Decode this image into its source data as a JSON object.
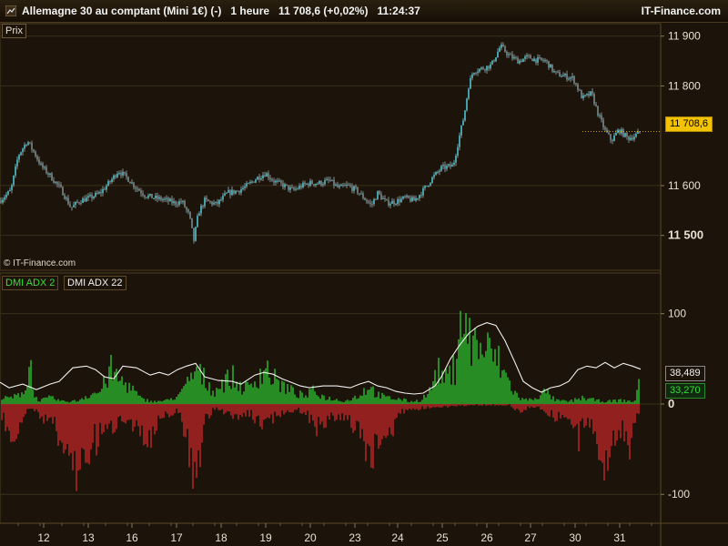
{
  "header": {
    "title": "Allemagne 30 au comptant (Mini 1€) (-)   1 heure   11 708,6 (+0,02%)   11:24:37",
    "brand": "IT-Finance.com"
  },
  "price_panel": {
    "label": "Prix",
    "copyright": "© IT-Finance.com",
    "current_price": "11 708,6",
    "axis_ticks": [
      "11 900",
      "11 800",
      "11 600",
      "11 500"
    ]
  },
  "indicator_panel": {
    "label_dmi": "DMI ADX 2",
    "label_adx": "DMI ADX 22",
    "adx_value": "38,489",
    "dmi_value": "33,270",
    "axis_ticks": [
      "100",
      "0",
      "-100"
    ]
  },
  "x_axis": {
    "ticks": [
      "12",
      "13",
      "16",
      "17",
      "18",
      "19",
      "20",
      "23",
      "24",
      "25",
      "26",
      "27",
      "30",
      "31"
    ]
  },
  "colors": {
    "background": "#1c140a",
    "candle_up": "#4fc3d0",
    "candle_down": "#7a8a8e",
    "dmi_positive": "#2fbf2f",
    "dmi_negative": "#c42626",
    "adx_line": "#f0f0f0",
    "price_badge": "#f3c200"
  },
  "chart_data": [
    {
      "type": "candlestick",
      "ylim": [
        11430,
        11925
      ],
      "yticks": [
        11900,
        11800,
        11600,
        11500
      ],
      "close_path": [
        [
          0,
          11570
        ],
        [
          12,
          11590
        ],
        [
          20,
          11660
        ],
        [
          30,
          11690
        ],
        [
          38,
          11665
        ],
        [
          45,
          11640
        ],
        [
          55,
          11620
        ],
        [
          68,
          11590
        ],
        [
          78,
          11555
        ],
        [
          88,
          11570
        ],
        [
          98,
          11575
        ],
        [
          110,
          11585
        ],
        [
          122,
          11610
        ],
        [
          130,
          11630
        ],
        [
          140,
          11615
        ],
        [
          150,
          11595
        ],
        [
          160,
          11580
        ],
        [
          170,
          11575
        ],
        [
          180,
          11572
        ],
        [
          192,
          11565
        ],
        [
          200,
          11568
        ],
        [
          208,
          11540
        ],
        [
          213,
          11490
        ],
        [
          218,
          11545
        ],
        [
          225,
          11570
        ],
        [
          238,
          11562
        ],
        [
          250,
          11585
        ],
        [
          262,
          11590
        ],
        [
          272,
          11600
        ],
        [
          282,
          11615
        ],
        [
          292,
          11625
        ],
        [
          300,
          11610
        ],
        [
          312,
          11600
        ],
        [
          322,
          11590
        ],
        [
          332,
          11600
        ],
        [
          340,
          11605
        ],
        [
          352,
          11605
        ],
        [
          362,
          11610
        ],
        [
          372,
          11595
        ],
        [
          382,
          11600
        ],
        [
          392,
          11590
        ],
        [
          400,
          11575
        ],
        [
          408,
          11560
        ],
        [
          415,
          11585
        ],
        [
          425,
          11565
        ],
        [
          435,
          11568
        ],
        [
          445,
          11575
        ],
        [
          455,
          11570
        ],
        [
          465,
          11590
        ],
        [
          475,
          11615
        ],
        [
          485,
          11635
        ],
        [
          498,
          11640
        ],
        [
          505,
          11700
        ],
        [
          510,
          11740
        ],
        [
          515,
          11800
        ],
        [
          520,
          11830
        ],
        [
          530,
          11835
        ],
        [
          540,
          11842
        ],
        [
          550,
          11880
        ],
        [
          560,
          11860
        ],
        [
          570,
          11850
        ],
        [
          580,
          11858
        ],
        [
          590,
          11852
        ],
        [
          600,
          11850
        ],
        [
          610,
          11825
        ],
        [
          620,
          11820
        ],
        [
          630,
          11815
        ],
        [
          640,
          11775
        ],
        [
          650,
          11785
        ],
        [
          658,
          11740
        ],
        [
          665,
          11710
        ],
        [
          672,
          11690
        ],
        [
          680,
          11712
        ],
        [
          690,
          11695
        ],
        [
          698,
          11700
        ],
        [
          704,
          11708.6
        ]
      ]
    },
    {
      "type": "bar",
      "name": "DMI ADX 2",
      "ylim": [
        -132,
        145
      ],
      "yticks": [
        100,
        0,
        -100
      ],
      "envelope_positive": [
        [
          2,
          8
        ],
        [
          18,
          12
        ],
        [
          30,
          30
        ],
        [
          34,
          75
        ],
        [
          38,
          10
        ],
        [
          45,
          6
        ],
        [
          55,
          10
        ],
        [
          70,
          4
        ],
        [
          85,
          5
        ],
        [
          95,
          14
        ],
        [
          110,
          20
        ],
        [
          122,
          55
        ],
        [
          130,
          40
        ],
        [
          142,
          30
        ],
        [
          155,
          8
        ],
        [
          170,
          4
        ],
        [
          185,
          6
        ],
        [
          200,
          18
        ],
        [
          215,
          55
        ],
        [
          225,
          40
        ],
        [
          235,
          20
        ],
        [
          245,
          35
        ],
        [
          255,
          45
        ],
        [
          262,
          30
        ],
        [
          275,
          25
        ],
        [
          285,
          50
        ],
        [
          292,
          60
        ],
        [
          300,
          42
        ],
        [
          310,
          30
        ],
        [
          322,
          20
        ],
        [
          335,
          12
        ],
        [
          345,
          22
        ],
        [
          355,
          12
        ],
        [
          365,
          8
        ],
        [
          380,
          5
        ],
        [
          395,
          14
        ],
        [
          405,
          30
        ],
        [
          415,
          15
        ],
        [
          425,
          10
        ],
        [
          440,
          8
        ],
        [
          450,
          4
        ],
        [
          462,
          6
        ],
        [
          472,
          20
        ],
        [
          480,
          55
        ],
        [
          490,
          40
        ],
        [
          500,
          60
        ],
        [
          505,
          155
        ],
        [
          512,
          115
        ],
        [
          520,
          100
        ],
        [
          530,
          90
        ],
        [
          540,
          82
        ],
        [
          548,
          68
        ],
        [
          555,
          48
        ],
        [
          562,
          28
        ],
        [
          570,
          10
        ],
        [
          580,
          6
        ],
        [
          590,
          12
        ],
        [
          600,
          20
        ],
        [
          610,
          6
        ],
        [
          625,
          4
        ],
        [
          640,
          10
        ],
        [
          655,
          6
        ],
        [
          665,
          4
        ],
        [
          680,
          6
        ],
        [
          698,
          4
        ],
        [
          702,
          40
        ]
      ],
      "envelope_negative": [
        [
          2,
          -22
        ],
        [
          15,
          -55
        ],
        [
          25,
          -18
        ],
        [
          38,
          -10
        ],
        [
          48,
          -22
        ],
        [
          60,
          -38
        ],
        [
          70,
          -70
        ],
        [
          78,
          -90
        ],
        [
          82,
          -120
        ],
        [
          88,
          -92
        ],
        [
          95,
          -75
        ],
        [
          105,
          -62
        ],
        [
          115,
          -48
        ],
        [
          128,
          -30
        ],
        [
          140,
          -20
        ],
        [
          150,
          -38
        ],
        [
          160,
          -55
        ],
        [
          165,
          -70
        ],
        [
          172,
          -40
        ],
        [
          182,
          -18
        ],
        [
          195,
          -10
        ],
        [
          205,
          -55
        ],
        [
          210,
          -92
        ],
        [
          214,
          -122
        ],
        [
          218,
          -95
        ],
        [
          224,
          -25
        ],
        [
          235,
          -10
        ],
        [
          248,
          -12
        ],
        [
          262,
          -20
        ],
        [
          275,
          -18
        ],
        [
          290,
          -32
        ],
        [
          300,
          -22
        ],
        [
          312,
          -12
        ],
        [
          322,
          -10
        ],
        [
          335,
          -12
        ],
        [
          350,
          -40
        ],
        [
          360,
          -28
        ],
        [
          372,
          -22
        ],
        [
          385,
          -30
        ],
        [
          398,
          -45
        ],
        [
          406,
          -96
        ],
        [
          412,
          -78
        ],
        [
          420,
          -40
        ],
        [
          430,
          -62
        ],
        [
          440,
          -12
        ],
        [
          450,
          -10
        ],
        [
          462,
          -8
        ],
        [
          470,
          -6
        ],
        [
          480,
          -4
        ],
        [
          490,
          -4
        ],
        [
          520,
          -2
        ],
        [
          560,
          -2
        ],
        [
          570,
          -12
        ],
        [
          580,
          -6
        ],
        [
          590,
          -4
        ],
        [
          610,
          -20
        ],
        [
          625,
          -22
        ],
        [
          635,
          -60
        ],
        [
          645,
          -30
        ],
        [
          655,
          -45
        ],
        [
          662,
          -100
        ],
        [
          668,
          -75
        ],
        [
          675,
          -50
        ],
        [
          685,
          -40
        ],
        [
          692,
          -72
        ],
        [
          698,
          -35
        ],
        [
          704,
          -4
        ]
      ]
    },
    {
      "type": "line",
      "name": "DMI ADX 22",
      "points": [
        [
          0,
          24
        ],
        [
          10,
          18
        ],
        [
          25,
          22
        ],
        [
          40,
          16
        ],
        [
          55,
          22
        ],
        [
          65,
          25
        ],
        [
          80,
          40
        ],
        [
          95,
          42
        ],
        [
          105,
          38
        ],
        [
          115,
          30
        ],
        [
          125,
          28
        ],
        [
          135,
          42
        ],
        [
          150,
          40
        ],
        [
          165,
          32
        ],
        [
          175,
          35
        ],
        [
          185,
          32
        ],
        [
          195,
          38
        ],
        [
          205,
          42
        ],
        [
          215,
          45
        ],
        [
          225,
          30
        ],
        [
          240,
          26
        ],
        [
          255,
          25
        ],
        [
          265,
          22
        ],
        [
          280,
          32
        ],
        [
          290,
          35
        ],
        [
          300,
          33
        ],
        [
          310,
          28
        ],
        [
          320,
          24
        ],
        [
          330,
          20
        ],
        [
          340,
          18
        ],
        [
          355,
          20
        ],
        [
          370,
          20
        ],
        [
          385,
          18
        ],
        [
          395,
          22
        ],
        [
          405,
          25
        ],
        [
          415,
          20
        ],
        [
          425,
          18
        ],
        [
          435,
          14
        ],
        [
          445,
          12
        ],
        [
          455,
          11
        ],
        [
          465,
          12
        ],
        [
          478,
          20
        ],
        [
          485,
          30
        ],
        [
          495,
          50
        ],
        [
          505,
          65
        ],
        [
          515,
          78
        ],
        [
          525,
          86
        ],
        [
          535,
          90
        ],
        [
          545,
          87
        ],
        [
          555,
          70
        ],
        [
          565,
          48
        ],
        [
          575,
          25
        ],
        [
          585,
          18
        ],
        [
          595,
          13
        ],
        [
          605,
          18
        ],
        [
          615,
          20
        ],
        [
          625,
          25
        ],
        [
          635,
          38
        ],
        [
          645,
          42
        ],
        [
          655,
          40
        ],
        [
          665,
          46
        ],
        [
          675,
          40
        ],
        [
          685,
          45
        ],
        [
          695,
          42
        ],
        [
          704,
          38.489
        ]
      ]
    }
  ]
}
